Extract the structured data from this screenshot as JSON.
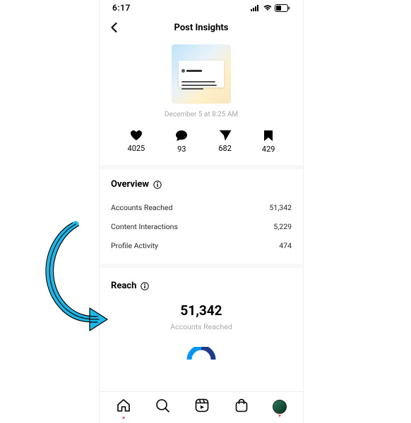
{
  "status": {
    "time": "6:17"
  },
  "header": {
    "title": "Post Insights"
  },
  "post": {
    "date": "December 5 at 8:25 AM"
  },
  "stats": {
    "likes": "4025",
    "comments": "93",
    "shares": "682",
    "saves": "429"
  },
  "overview": {
    "title": "Overview",
    "rows": [
      {
        "label": "Accounts Reached",
        "value": "51,342"
      },
      {
        "label": "Content Interactions",
        "value": "5,229"
      },
      {
        "label": "Profile Activity",
        "value": "474"
      }
    ]
  },
  "reach": {
    "title": "Reach",
    "number": "51,342",
    "caption": "Accounts Reached"
  }
}
